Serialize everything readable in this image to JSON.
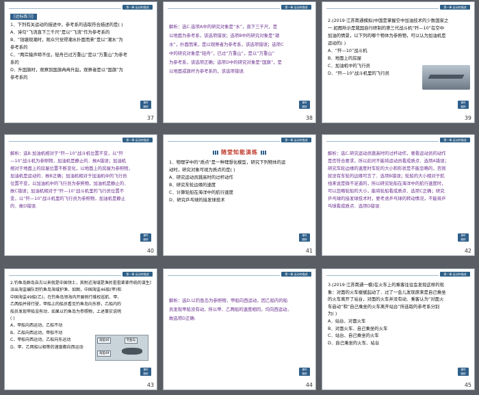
{
  "slides": [
    {
      "number": "37",
      "chip": "第一章  运动的描述",
      "header": "[达标练习]",
      "lines": [
        "1．下列有关运动的描述中，参考系的选取符合描述的是(      )",
        "A．诗句“飞流直下三千尺”是以“飞流”作为参考系的",
        "B．“钱塘观潮时，观众只觉得潮水扑面而来”是以“潮水”为",
        "参考系的",
        "C．“两岸猿声啼不住，轻舟已过万重山”是以“万重山”为参考",
        "系的",
        "D．升国旗时，观察到国旗冉冉升起，观察者是以“国旗”为",
        "参考系的"
      ],
      "badge": "课时\n跟踪"
    },
    {
      "number": "38",
      "chip": "第一章  运动的描述",
      "lines": [
        "解析：选C.选项A中的研究对象是“水”，直下三千尺，是",
        "以地面为参考系，该选项错误；选项B中的研究对象是“潮",
        "水”，扑面而来，是以观察者为参考系，该选项错误；选项C",
        "中的研究对象是“轻舟”，已过“万重山”，是以“万重山”",
        "为参考系，该选项正确；选项D中的研究对象是“国旗”，是",
        "以地面或旗杆为参考系的，该选项错误."
      ],
      "badge": "课时\n跟踪"
    },
    {
      "number": "39",
      "chip": "第一章  运动的描述",
      "lines": [
        "2.(2019·江苏南通模拟)中国是掌握空中加油技术的少数国家之",
        "一.如图所示是我国自行研制的第三代战斗机“歼—10”在空中",
        "加油的情景，以下列的哪个物体为参照物，可以认为加油机是",
        "运动的(      )",
        "A．“歼—10”战斗机",
        "B．地面上的房屋",
        "C．加油机中的飞行员",
        "D．“歼—10”战斗机里的飞行员"
      ],
      "badge": "课时\n跟踪"
    },
    {
      "number": "40",
      "chip": "第一章  运动的描述",
      "lines": [
        "解析：选B.加油机相对于“歼—10”战斗机位置不变，以“歼",
        "—10”战斗机为参照物，加油机是静止的．故A错误；加油机",
        "相对于地面上的房屋位置不断变化，以地面上的房屋为参照物，",
        "加油机是运动的．故B正确；加油机相对于加油机中的飞行员",
        "位置不变，以加油机中的飞行员为参照物，加油机是静止的．",
        "故C错误；加油机相对于“歼—10”战斗机里的飞行员位置不",
        "变，以“歼—10”战斗机里的飞行员为参照物，加油机是静止",
        "的．故D错误."
      ],
      "badge": "课时\n跟踪"
    },
    {
      "number": "41",
      "chip": "第一章  运动的描述",
      "section": "随堂知能演练",
      "lines": [
        "1．物理学中的“质点”是一种理想化模型，研究下列物体的运",
        "动时，研究对象可视为质点的是(      )",
        "A．研究运动员跳高时的过杆动作",
        "B．研究车轮边缘的速度",
        "C．计算轮船在海洋中的航行速度",
        "D．研究乒乓球的接发球技术"
      ],
      "badge": "课时\n跟踪"
    },
    {
      "number": "42",
      "chip": "第一章  运动的描述",
      "lines": [
        "解析：选C.研究运动员跳高时的过杆动作，要看运动员的动作",
        "是否符合要求，所以此时不能将运动员看成质点．选项A错误；",
        "研究车轮边缘的速度时车轮的大小和形状是不能忽略的，否则",
        "就没有车轮的边缘可言了．选项B错误；轮船的大小相对于航",
        "线来说是微不足道的，所以研究轮船在海洋中的航行速度时，",
        "可以忽略轮船的大小，能将轮船看成质点．选项C正确；研究",
        "乒乓球的接发球技术时，要考虑乒乓球的转动情况，不能将乒",
        "乓球看成质点．选项D错误."
      ],
      "badge": "课时\n跟踪"
    },
    {
      "number": "43",
      "chip": "第一章  运动的描述",
      "lines": [
        "2.钓鱼岛群岛自古以来就是中国领土，其附近海域是渔民祖祖辈辈传统的谋生渔场．我国",
        "派出海监编队到钓鱼岛海域护渔．如图，中国海监46船(甲)和",
        "中国海监49船(乙)，在钓鱼岛领海内开展例行维权巡航．甲、",
        "乙两船并排行驶，甲船上的船员看见钓鱼岛向东移，乙船内的",
        "船员发现甲船没有动．如果以钓鱼岛为参照物，上述事实说明",
        "(      )",
        "A．甲船向西运动，乙船不动",
        "B．乙船向西运动，甲船不动",
        "C．甲船向西运动，乙船向东运动",
        "D．甲、乙两船以相等的速度都向西运动"
      ],
      "map_labels": [
        "海监46",
        "钓鱼岛",
        "海监49"
      ],
      "badge": "课时\n跟踪"
    },
    {
      "number": "44",
      "chip": "第一章  运动的描述",
      "lines": [
        "解析：选D.以钓鱼岛为参照物，甲船向西运动，因乙船内的船",
        "员发现甲船没有动，所以甲、乙两船的速度相同，均向西运动，",
        "故选项D正确."
      ],
      "badge": "课时\n跟踪"
    },
    {
      "number": "45",
      "chip": "第一章  运动的描述",
      "lines": [
        "3.(2019·江苏南通一模)在火车上的乘客往往会发现这样的现",
        "象：对面的火车缓缓起动了．过了一会儿发现原来是自己乘坐",
        "的火车离开了站台，对面的火车并没有动．乘客认为“对面火",
        "车启动”和“自己乘坐的火车离开站台”所选取的参考系分别",
        "为(      )",
        "A．站台、对面火车",
        "B．对面火车、自己乘坐的火车",
        "C．站台、自己乘坐的火车",
        "D．自己乘坐的火车、站台"
      ],
      "badge": "课时\n跟踪"
    }
  ]
}
